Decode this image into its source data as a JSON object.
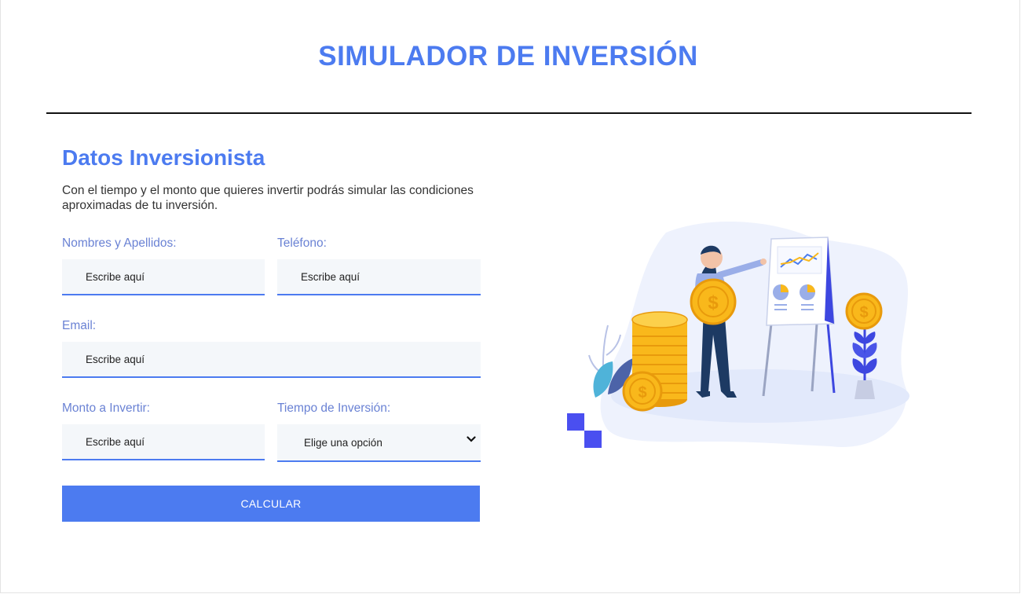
{
  "header": {
    "title": "SIMULADOR DE INVERSIÓN"
  },
  "form": {
    "section_title": "Datos Inversionista",
    "description": "Con el tiempo y el monto que quieres invertir podrás simular las condiciones aproximadas de tu inversión.",
    "fields": {
      "name": {
        "label": "Nombres y Apellidos:",
        "placeholder": "Escribe aquí"
      },
      "phone": {
        "label": "Teléfono:",
        "placeholder": "Escribe aquí"
      },
      "email": {
        "label": "Email:",
        "placeholder": "Escribe aquí"
      },
      "amount": {
        "label": "Monto a Invertir:",
        "placeholder": "Escribe aquí"
      },
      "term": {
        "label": "Tiempo de Inversión:",
        "selected": "Elige una opción"
      }
    },
    "submit_label": "CALCULAR"
  },
  "colors": {
    "accent": "#4c7bf0",
    "label": "#6a82d4",
    "input_bg": "#f4f7fa",
    "coin": "#f9b81b"
  },
  "illustration": {
    "icons": [
      "investor-woman-icon",
      "coin-stack-icon",
      "presentation-board-icon",
      "money-plant-icon",
      "leaf-icon",
      "pixel-squares-icon"
    ]
  }
}
